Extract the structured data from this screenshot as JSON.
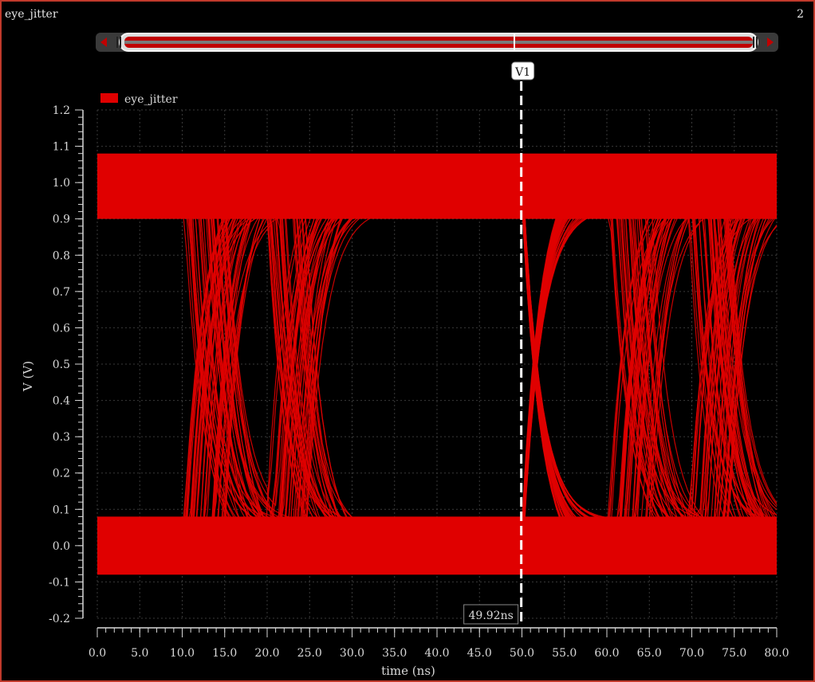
{
  "window": {
    "title": "eye_jitter",
    "subplot_index": "2"
  },
  "cursor": {
    "name": "V1",
    "x": 49.92,
    "readout": "49.92ns",
    "color": "#ffffff"
  },
  "chart_data": {
    "type": "line",
    "title": "",
    "xlabel": "time (ns)",
    "ylabel": "V (V)",
    "xlim": [
      0.0,
      80.0
    ],
    "ylim": [
      -0.2,
      1.2
    ],
    "x_ticks": [
      "0.0",
      "5.0",
      "10.0",
      "15.0",
      "20.0",
      "25.0",
      "30.0",
      "35.0",
      "40.0",
      "45.0",
      "50.0",
      "55.0",
      "60.0",
      "65.0",
      "70.0",
      "75.0",
      "80.0"
    ],
    "y_ticks": [
      "1.2",
      "1.1",
      "1.0",
      "0.9",
      "0.8",
      "0.7",
      "0.6",
      "0.5",
      "0.4",
      "0.3",
      "0.2",
      "0.1",
      "0.0",
      "-0.1",
      "-0.2"
    ],
    "grid": true,
    "legend_position": "top-left",
    "series": [
      {
        "name": "eye_jitter",
        "color": "#e00000",
        "description_free": true,
        "high_level": 1.0,
        "low_level": 0.0,
        "level_noise": 0.14,
        "unit_interval": 50.0,
        "crossings": [
          12.5,
          22.0,
          62.5,
          72.0
        ],
        "crossing_jitter": 2.5
      }
    ]
  },
  "colors": {
    "background": "#000000",
    "frame_border": "#c0392b",
    "grid": "#3a3a3a",
    "axis_text": "#d8d8d8",
    "trace": "#e00000",
    "scrollbar_track": "#d0d0d0"
  }
}
